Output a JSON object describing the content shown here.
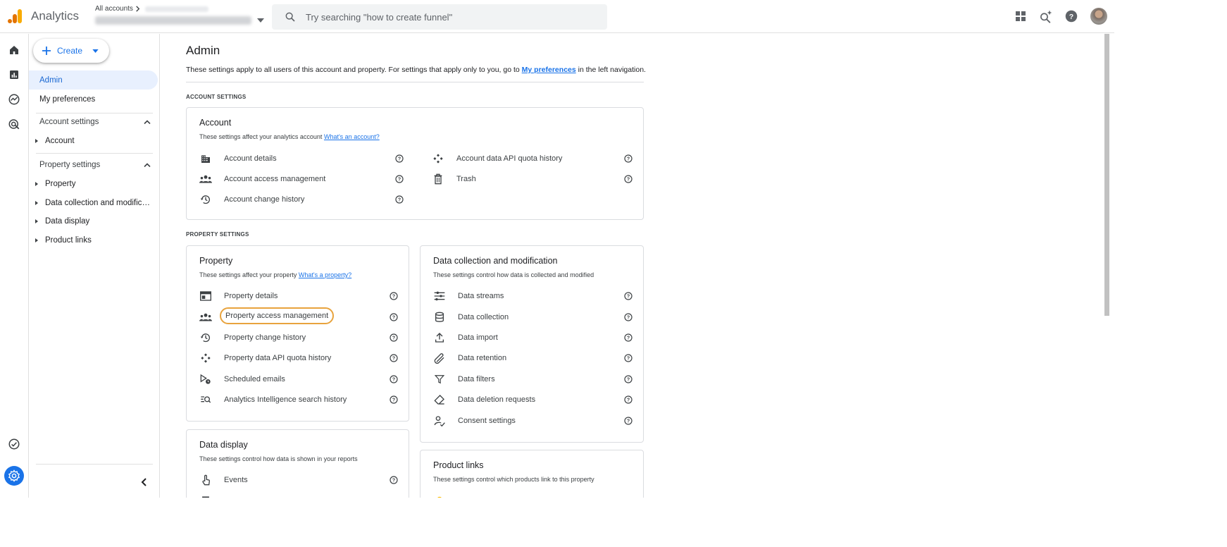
{
  "header": {
    "app_name": "Analytics",
    "all_accounts": "All accounts",
    "search_placeholder": "Try searching \"how to create funnel\""
  },
  "sidenav": {
    "create_label": "Create",
    "admin": "Admin",
    "my_preferences": "My preferences",
    "account_settings": "Account settings",
    "account": "Account",
    "property_settings": "Property settings",
    "property": "Property",
    "data_collection": "Data collection and modifica…",
    "data_display": "Data display",
    "product_links": "Product links"
  },
  "main": {
    "title": "Admin",
    "desc_prefix": "These settings apply to all users of this account and property. For settings that apply only to you, go to",
    "desc_link": "My preferences",
    "desc_suffix": "in the left navigation.",
    "account_settings_label": "ACCOUNT SETTINGS",
    "property_settings_label": "PROPERTY SETTINGS",
    "account_card": {
      "title": "Account",
      "desc": "These settings affect your analytics account",
      "link": "What's an account?",
      "items_left": [
        "Account details",
        "Account access management",
        "Account change history"
      ],
      "items_right": [
        "Account data API quota history",
        "Trash"
      ]
    },
    "property_card": {
      "title": "Property",
      "desc": "These settings affect your property",
      "link": "What's a property?",
      "items": [
        "Property details",
        "Property access management",
        "Property change history",
        "Property data API quota history",
        "Scheduled emails",
        "Analytics Intelligence search history"
      ]
    },
    "data_collection_card": {
      "title": "Data collection and modification",
      "desc": "These settings control how data is collected and modified",
      "items": [
        "Data streams",
        "Data collection",
        "Data import",
        "Data retention",
        "Data filters",
        "Data deletion requests",
        "Consent settings"
      ]
    },
    "data_display_card": {
      "title": "Data display",
      "desc": "These settings control how data is shown in your reports",
      "items": [
        "Events"
      ]
    },
    "product_links_card": {
      "title": "Product links",
      "desc": "These settings control which products link to this property"
    }
  },
  "colors": {
    "accent": "#1a73e8",
    "highlight": "#e8a33d",
    "logo_orange": "#f9ab00",
    "logo_dark": "#e37400"
  }
}
